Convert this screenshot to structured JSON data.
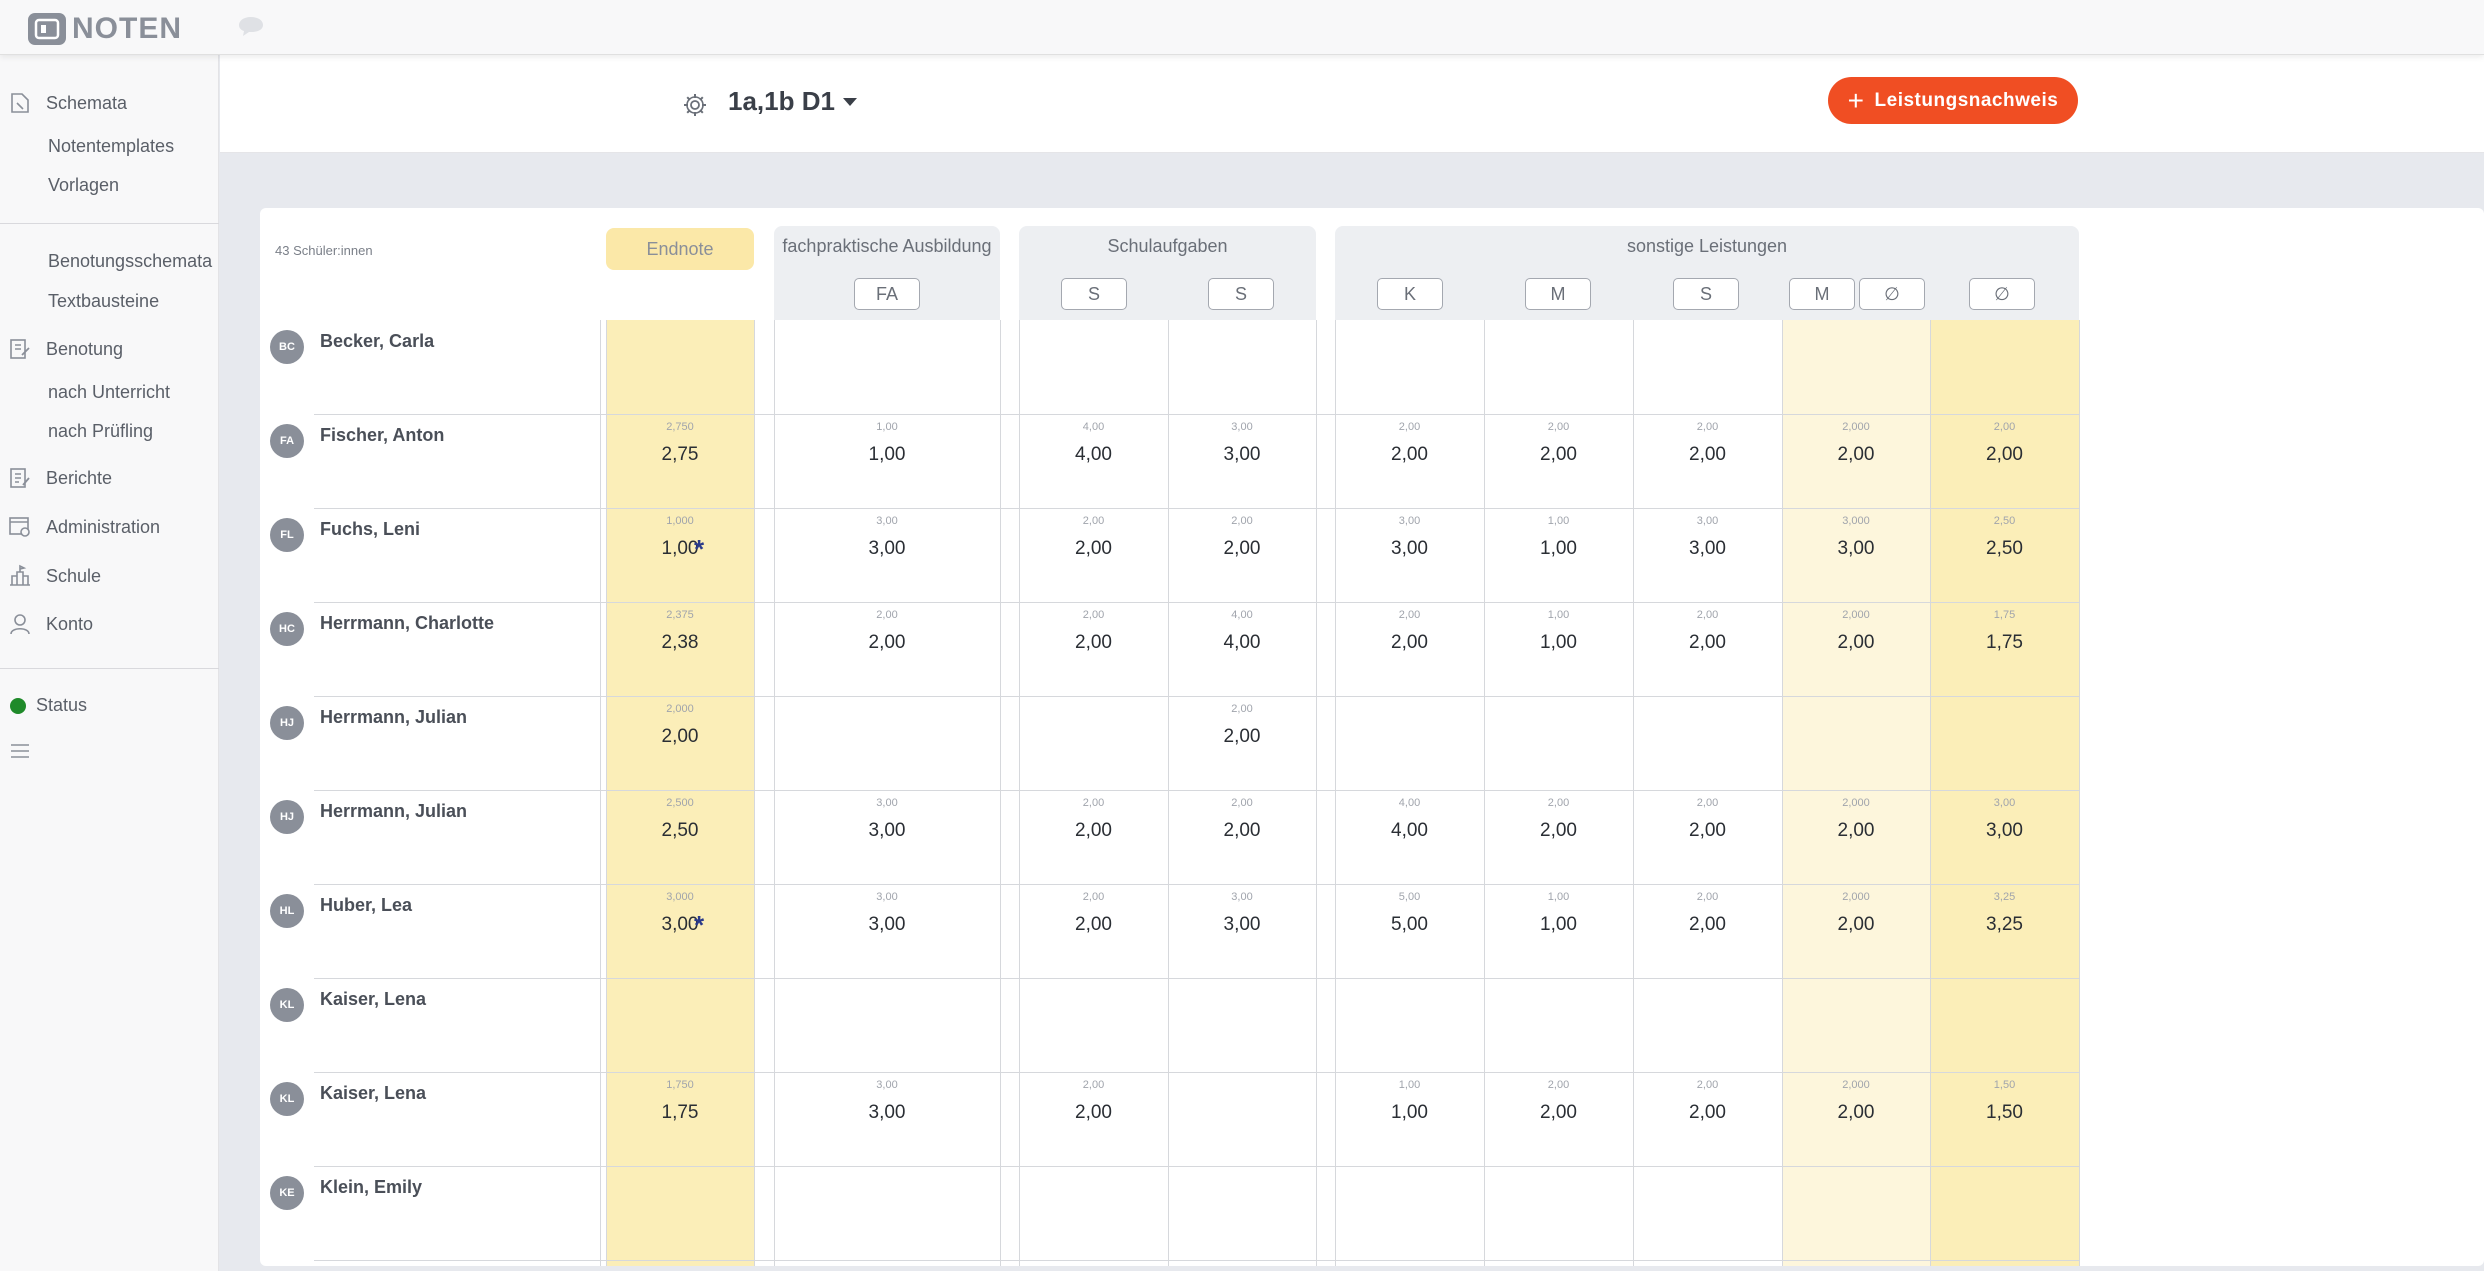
{
  "app": {
    "logo_text": "NOTEN"
  },
  "sidebar": {
    "items": [
      {
        "label": "Schemata",
        "icon": "pen-note-icon"
      },
      {
        "label": "Notentemplates"
      },
      {
        "label": "Vorlagen"
      },
      {
        "label": "Benotungsschemata"
      },
      {
        "label": "Textbausteine"
      },
      {
        "label": "Benotung",
        "icon": "edit-note-icon"
      },
      {
        "label": "nach Unterricht"
      },
      {
        "label": "nach Prüfling"
      },
      {
        "label": "Berichte",
        "icon": "report-icon"
      },
      {
        "label": "Administration",
        "icon": "admin-icon"
      },
      {
        "label": "Schule",
        "icon": "school-icon"
      },
      {
        "label": "Konto",
        "icon": "user-icon"
      }
    ],
    "status_label": "Status",
    "status_color": "#1f8a2a"
  },
  "header": {
    "class_title": "1a,1b D1",
    "add_button_label": "Leistungsnachweis",
    "add_button_color": "#f04e23"
  },
  "table": {
    "count_label": "43 Schüler:innen",
    "endnote_label": "Endnote",
    "groups": [
      {
        "title": "fachpraktische Ausbildung",
        "columns": [
          "FA"
        ]
      },
      {
        "title": "Schulaufgaben",
        "columns": [
          "S",
          "S"
        ]
      },
      {
        "title": "sonstige Leistungen",
        "columns": [
          "K",
          "M",
          "S",
          "M",
          "∅",
          "∅"
        ]
      }
    ],
    "rows": [
      {
        "initials": "BC",
        "name": "Becker, Carla",
        "cells": [
          null,
          null,
          null,
          null,
          null,
          null,
          null,
          null,
          null
        ]
      },
      {
        "initials": "FA",
        "name": "Fischer, Anton",
        "cells": [
          {
            "s": "2,750",
            "v": "2,75"
          },
          {
            "s": "1,00",
            "v": "1,00"
          },
          {
            "s": "4,00",
            "v": "4,00"
          },
          {
            "s": "3,00",
            "v": "3,00"
          },
          {
            "s": "2,00",
            "v": "2,00"
          },
          {
            "s": "2,00",
            "v": "2,00"
          },
          {
            "s": "2,00",
            "v": "2,00"
          },
          {
            "s": "2,000",
            "v": "2,00"
          },
          {
            "s": "2,00",
            "v": "2,00"
          }
        ]
      },
      {
        "initials": "FL",
        "name": "Fuchs, Leni",
        "cells": [
          {
            "s": "1,000",
            "v": "1,00",
            "star": "*"
          },
          {
            "s": "3,00",
            "v": "3,00"
          },
          {
            "s": "2,00",
            "v": "2,00"
          },
          {
            "s": "2,00",
            "v": "2,00"
          },
          {
            "s": "3,00",
            "v": "3,00"
          },
          {
            "s": "1,00",
            "v": "1,00"
          },
          {
            "s": "3,00",
            "v": "3,00"
          },
          {
            "s": "3,000",
            "v": "3,00"
          },
          {
            "s": "2,50",
            "v": "2,50"
          }
        ]
      },
      {
        "initials": "HC",
        "name": "Herrmann, Charlotte",
        "cells": [
          {
            "s": "2,375",
            "v": "2,38"
          },
          {
            "s": "2,00",
            "v": "2,00"
          },
          {
            "s": "2,00",
            "v": "2,00"
          },
          {
            "s": "4,00",
            "v": "4,00"
          },
          {
            "s": "2,00",
            "v": "2,00"
          },
          {
            "s": "1,00",
            "v": "1,00"
          },
          {
            "s": "2,00",
            "v": "2,00"
          },
          {
            "s": "2,000",
            "v": "2,00"
          },
          {
            "s": "1,75",
            "v": "1,75"
          }
        ]
      },
      {
        "initials": "HJ",
        "name": "Herrmann, Julian",
        "cells": [
          {
            "s": "2,000",
            "v": "2,00"
          },
          null,
          null,
          {
            "s": "2,00",
            "v": "2,00"
          },
          null,
          null,
          null,
          null,
          null
        ]
      },
      {
        "initials": "HJ",
        "name": "Herrmann, Julian",
        "cells": [
          {
            "s": "2,500",
            "v": "2,50"
          },
          {
            "s": "3,00",
            "v": "3,00"
          },
          {
            "s": "2,00",
            "v": "2,00"
          },
          {
            "s": "2,00",
            "v": "2,00"
          },
          {
            "s": "4,00",
            "v": "4,00"
          },
          {
            "s": "2,00",
            "v": "2,00"
          },
          {
            "s": "2,00",
            "v": "2,00"
          },
          {
            "s": "2,000",
            "v": "2,00"
          },
          {
            "s": "3,00",
            "v": "3,00"
          }
        ]
      },
      {
        "initials": "HL",
        "name": "Huber, Lea",
        "cells": [
          {
            "s": "3,000",
            "v": "3,00",
            "star": "*"
          },
          {
            "s": "3,00",
            "v": "3,00"
          },
          {
            "s": "2,00",
            "v": "2,00"
          },
          {
            "s": "3,00",
            "v": "3,00"
          },
          {
            "s": "5,00",
            "v": "5,00"
          },
          {
            "s": "1,00",
            "v": "1,00"
          },
          {
            "s": "2,00",
            "v": "2,00"
          },
          {
            "s": "2,000",
            "v": "2,00"
          },
          {
            "s": "3,25",
            "v": "3,25"
          }
        ]
      },
      {
        "initials": "KL",
        "name": "Kaiser, Lena",
        "cells": [
          null,
          null,
          null,
          null,
          null,
          null,
          null,
          null,
          null
        ]
      },
      {
        "initials": "KL",
        "name": "Kaiser, Lena",
        "cells": [
          {
            "s": "1,750",
            "v": "1,75"
          },
          {
            "s": "3,00",
            "v": "3,00"
          },
          {
            "s": "2,00",
            "v": "2,00"
          },
          null,
          {
            "s": "1,00",
            "v": "1,00"
          },
          {
            "s": "2,00",
            "v": "2,00"
          },
          {
            "s": "2,00",
            "v": "2,00"
          },
          {
            "s": "2,000",
            "v": "2,00"
          },
          {
            "s": "1,50",
            "v": "1,50"
          }
        ]
      },
      {
        "initials": "KE",
        "name": "Klein, Emily",
        "cells": [
          null,
          null,
          null,
          null,
          null,
          null,
          null,
          null,
          null
        ]
      }
    ],
    "colors": {
      "endnote_bg": "#fbeeb8",
      "avg_light_bg": "#fdf6dc",
      "avg_bg": "#fbeeb8"
    }
  }
}
